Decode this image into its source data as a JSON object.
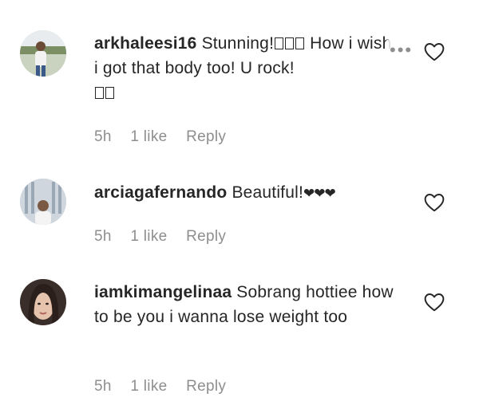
{
  "comments": [
    {
      "username": "arkhaleesi16",
      "text_before": "Stunning!",
      "text_after": " How i wish i got that body too! U rock!",
      "time": "5h",
      "likes": "1 like",
      "reply": "Reply",
      "more_icon": "ellipsis-icon",
      "heart_icon": "heart-outline-icon"
    },
    {
      "username": "arciagafernando",
      "text": "Beautiful!",
      "emoji_hearts": "❤❤❤",
      "time": "5h",
      "likes": "1 like",
      "reply": "Reply",
      "heart_icon": "heart-outline-icon"
    },
    {
      "username": "iamkimangelinaa",
      "text": "Sobrang hottiee how to be you i wanna lose weight too",
      "time": "5h",
      "likes": "1 like",
      "reply": "Reply",
      "heart_icon": "heart-outline-icon"
    }
  ],
  "colors": {
    "text": "#262626",
    "meta": "#8e8e8e"
  }
}
